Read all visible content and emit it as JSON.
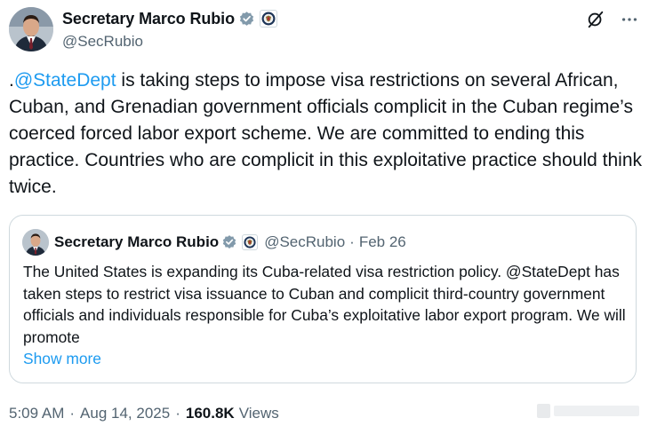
{
  "author": {
    "display_name": "Secretary Marco Rubio",
    "handle": "@SecRubio"
  },
  "tweet": {
    "prefix": ".",
    "mention": "@StateDept",
    "body": " is taking steps to impose visa restrictions on several African, Cuban, and Grenadian government officials complicit in the Cuban regime’s coerced forced labor export scheme. We are committed to ending this practice. Countries who are complicit in this exploitative practice should think twice."
  },
  "quote": {
    "display_name": "Secretary Marco Rubio",
    "handle": "@SecRubio",
    "separator": "·",
    "date": "Feb 26",
    "text": "The United States is expanding its Cuba-related visa restriction policy. @StateDept has taken steps to restrict visa issuance to Cuban and complicit third-country government officials and individuals responsible for Cuba’s exploitative labor export program. We will promote",
    "show_more": "Show more"
  },
  "footer": {
    "time": "5:09 AM",
    "separator": "·",
    "date": "Aug 14, 2025",
    "separator2": "·",
    "views_count": "160.8K",
    "views_label": "Views"
  },
  "colors": {
    "link": "#1d9bf0",
    "verified_badge": "#829aab",
    "secondary_text": "#536471"
  },
  "icons": {
    "grok": "grok-icon",
    "more": "more-icon",
    "verified": "verified-badge-icon",
    "seal": "state-dept-seal-icon"
  }
}
